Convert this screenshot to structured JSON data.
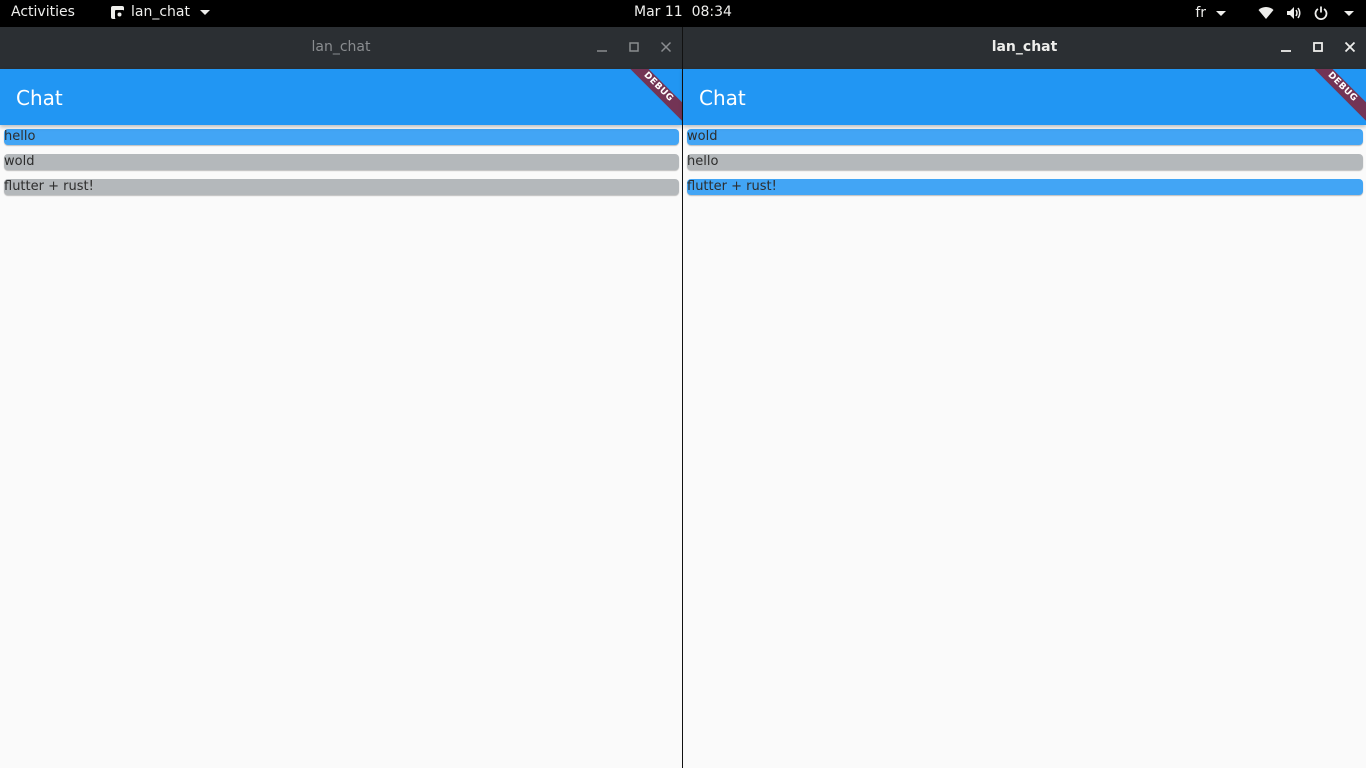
{
  "topbar": {
    "activities": "Activities",
    "app_name": "lan_chat",
    "date": "Mar 11",
    "time": "08:34",
    "keyboard_layout": "fr"
  },
  "windows": [
    {
      "title": "lan_chat",
      "focused": false,
      "appbar_title": "Chat",
      "debug_label": "DEBUG",
      "messages": [
        {
          "text": "hello",
          "mine": true
        },
        {
          "text": "wold",
          "mine": false
        },
        {
          "text": "flutter + rust!",
          "mine": false
        }
      ]
    },
    {
      "title": "lan_chat",
      "focused": true,
      "appbar_title": "Chat",
      "debug_label": "DEBUG",
      "messages": [
        {
          "text": "wold",
          "mine": true
        },
        {
          "text": "hello",
          "mine": false
        },
        {
          "text": "flutter + rust!",
          "mine": true
        }
      ]
    }
  ],
  "colors": {
    "appbar": "#2196f3",
    "bubble_mine": "#42a5f5",
    "bubble_other": "#b4b8bb",
    "titlebar": "#2b2f33"
  },
  "icons": {
    "wifi": "wifi-icon",
    "volume": "volume-icon",
    "power": "power-icon",
    "minimize": "minimize-icon",
    "maximize": "maximize-icon",
    "close": "close-icon"
  }
}
